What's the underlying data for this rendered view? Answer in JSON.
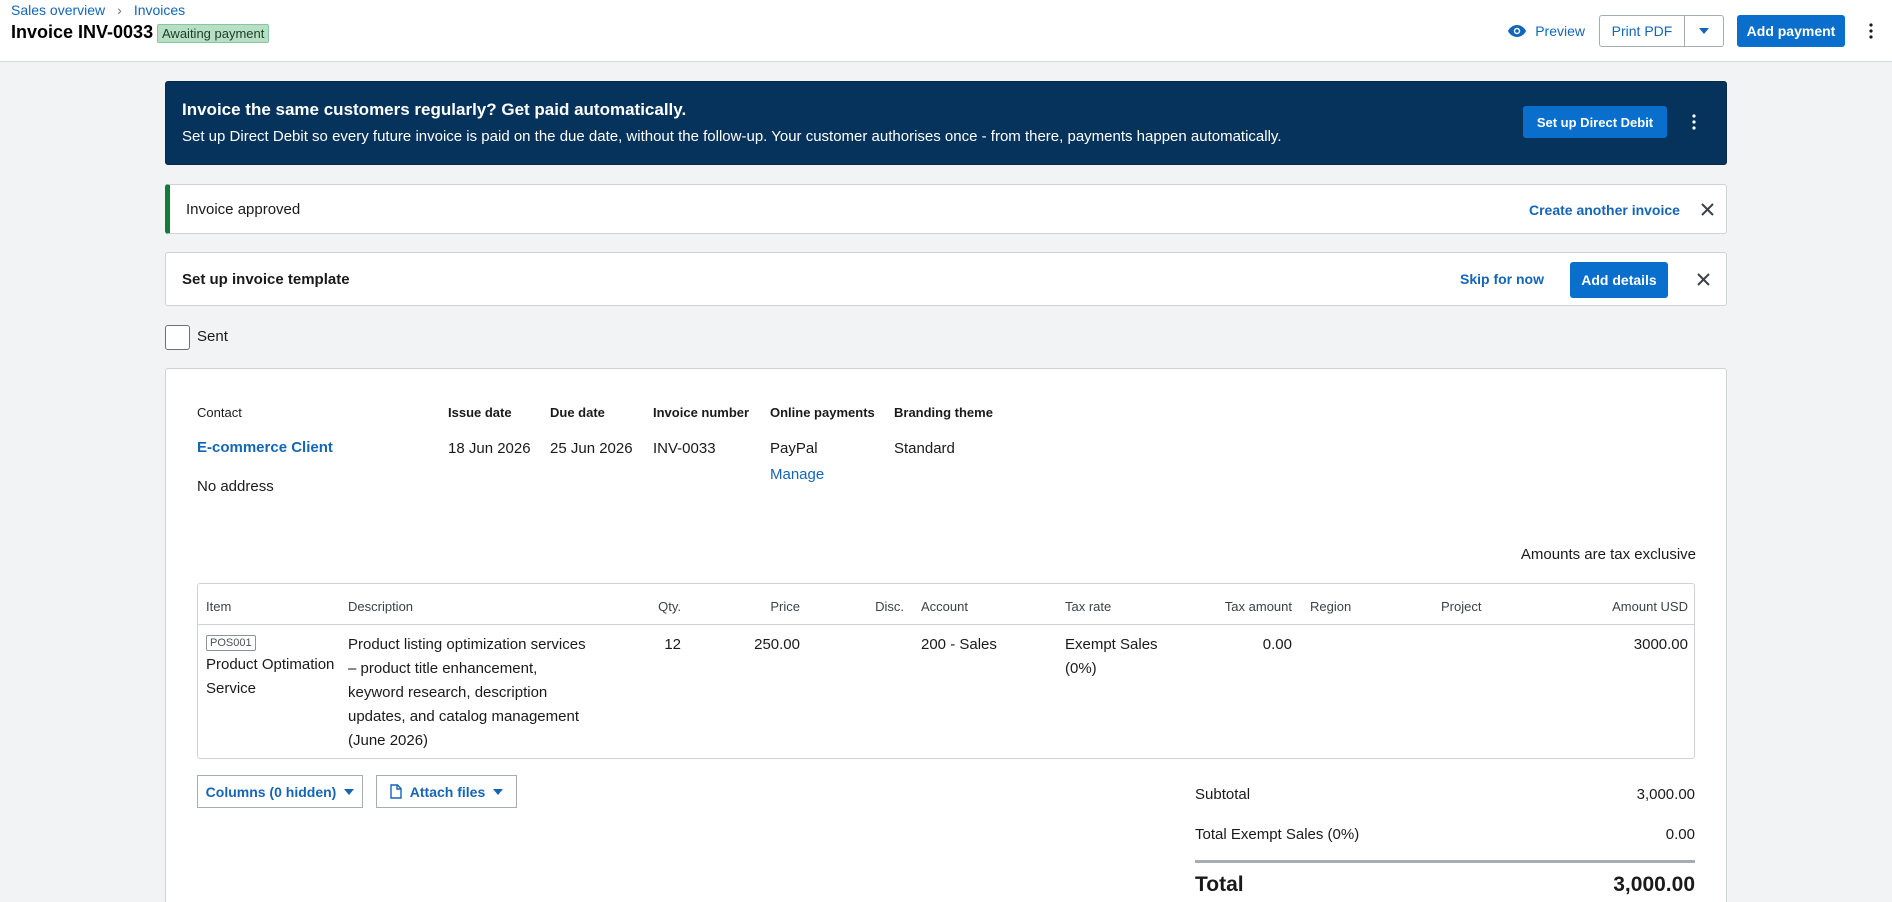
{
  "breadcrumb": {
    "items": [
      "Sales overview",
      "Invoices"
    ],
    "separator": "›"
  },
  "header": {
    "title": "Invoice INV-0033",
    "status": "Awaiting payment",
    "preview_label": "Preview",
    "print_label": "Print PDF",
    "add_payment_label": "Add payment"
  },
  "banner": {
    "title": "Invoice the same customers regularly? Get paid automatically.",
    "text": "Set up Direct Debit so every future invoice is paid on the due date, without the follow-up. Your customer authorises once - from there, payments happen automatically.",
    "button_label": "Set up Direct Debit"
  },
  "notice": {
    "text": "Invoice approved",
    "link_label": "Create another invoice"
  },
  "template_setup": {
    "title": "Set up invoice template",
    "skip_label": "Skip for now",
    "add_label": "Add details"
  },
  "sent": {
    "label": "Sent",
    "checked": false
  },
  "invoice": {
    "labels": {
      "contact": "Contact",
      "issue_date": "Issue date",
      "due_date": "Due date",
      "invoice_number": "Invoice number",
      "online_payments": "Online payments",
      "branding_theme": "Branding theme"
    },
    "contact_name": "E-commerce Client",
    "address": "No address",
    "issue_date": "18 Jun 2026",
    "due_date": "25 Jun 2026",
    "invoice_number": "INV-0033",
    "online_payments": "PayPal",
    "manage_label": "Manage",
    "branding_theme": "Standard",
    "tax_note": "Amounts are tax exclusive"
  },
  "table": {
    "columns": [
      "Item",
      "Description",
      "Qty.",
      "Price",
      "Disc.",
      "Account",
      "Tax rate",
      "Tax amount",
      "Region",
      "Project",
      "Amount USD"
    ],
    "rows": [
      {
        "item_code": "POS001",
        "item_name": "Product Optimation Service",
        "description": "Product listing optimization services – product title enhancement, keyword research, description updates, and catalog management (June 2026)",
        "qty": "12",
        "price": "250.00",
        "disc": "",
        "account": "200 - Sales",
        "tax_rate": "Exempt Sales (0%)",
        "tax_amount": "0.00",
        "region": "",
        "project": "",
        "amount": "3000.00"
      }
    ]
  },
  "actions": {
    "columns_label": "Columns (0 hidden)",
    "attach_label": "Attach files"
  },
  "totals": {
    "subtotal_label": "Subtotal",
    "subtotal": "3,000.00",
    "exempt_label": "Total Exempt Sales (0%)",
    "exempt": "0.00",
    "total_label": "Total",
    "total": "3,000.00"
  },
  "colors": {
    "primary": "#0a6fcc",
    "link": "#1465b8",
    "banner": "#06335c",
    "success": "#0f7b3d",
    "badge": "#b6dfc4"
  }
}
